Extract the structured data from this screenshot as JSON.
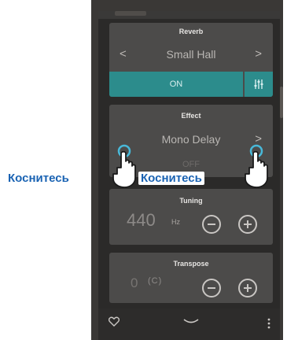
{
  "reverb": {
    "title": "Reverb",
    "value": "Small Hall",
    "prev_glyph": "<",
    "next_glyph": ">",
    "on_label": "ON",
    "settings_icon": "sliders-icon"
  },
  "effect": {
    "title": "Effect",
    "value": "Mono Delay",
    "next_glyph": ">",
    "state_label": "OFF"
  },
  "tuning": {
    "title": "Tuning",
    "value": "440",
    "unit": "Hz"
  },
  "transpose": {
    "title": "Transpose",
    "value": "0",
    "key": "(C)"
  },
  "bottom_bar": {
    "favorite_icon": "heart-icon",
    "handle_icon": "chevron-down-icon",
    "menu_icon": "more-vertical-icon"
  },
  "hints": {
    "left_label": "Коснитесь",
    "right_label": "Коснитесь"
  },
  "colors": {
    "accent": "#2c8c8c",
    "hint_text": "#1a63b3",
    "touch_ring": "#48b8d8"
  }
}
